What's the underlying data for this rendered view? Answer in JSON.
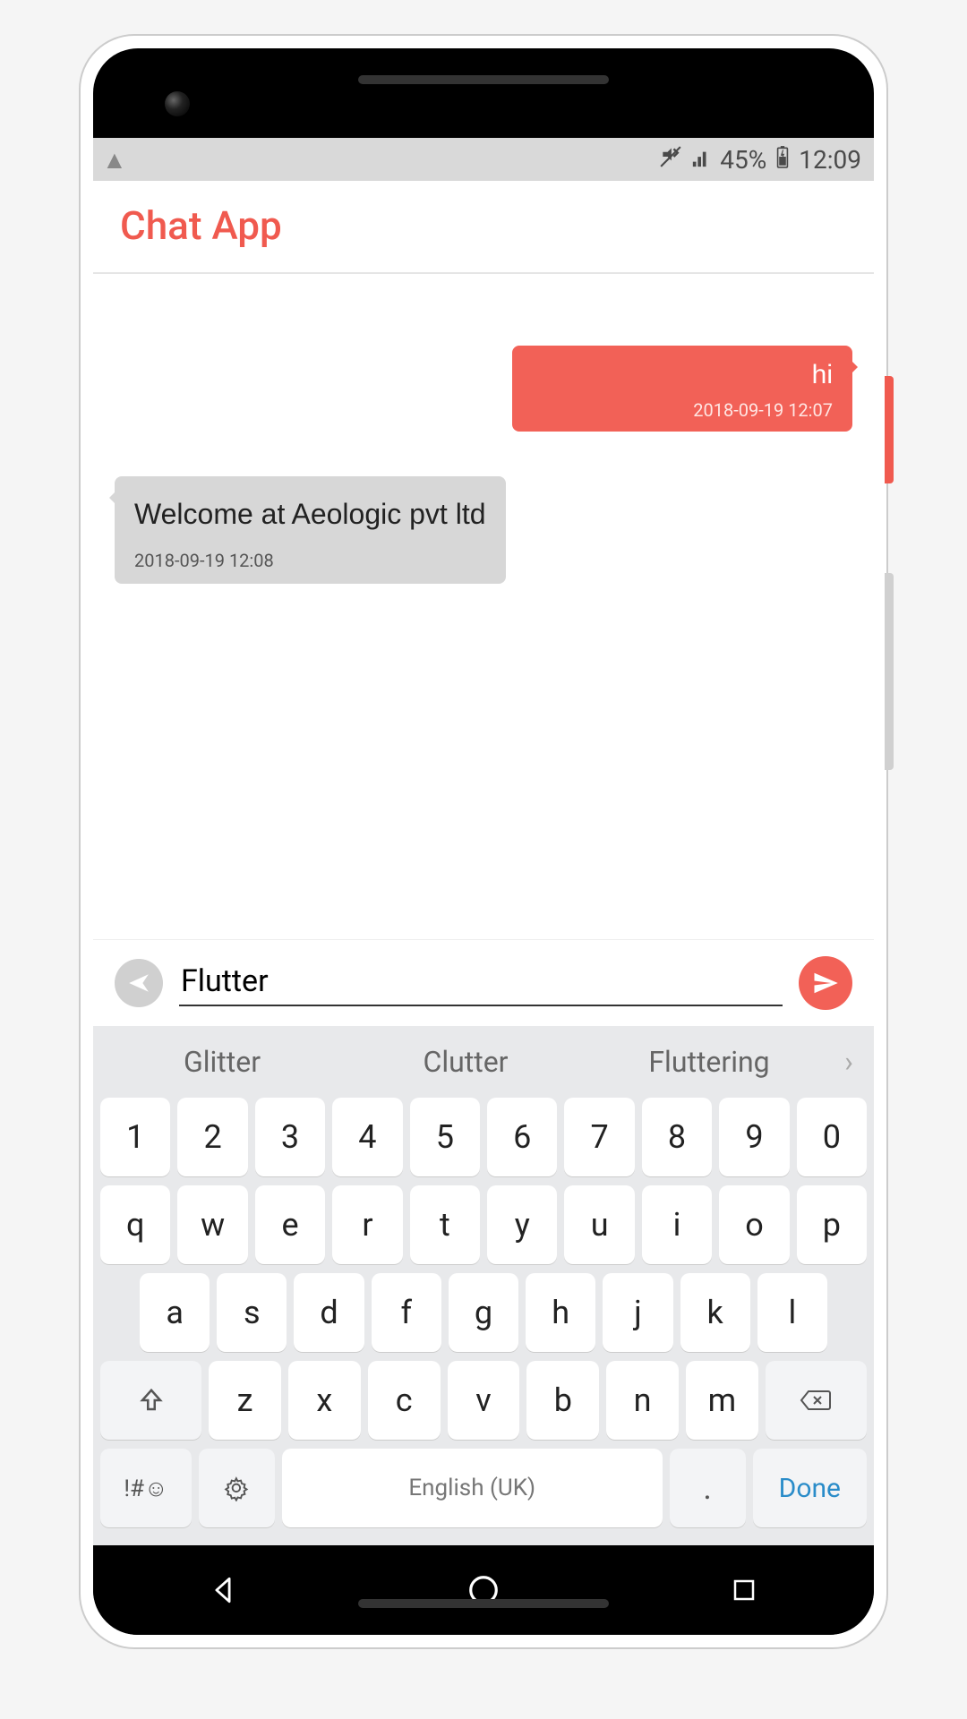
{
  "status_bar": {
    "battery_text": "45%",
    "time": "12:09"
  },
  "app": {
    "title": "Chat App"
  },
  "chat": {
    "messages": [
      {
        "side": "out",
        "text": "hi",
        "time": "2018-09-19 12:07"
      },
      {
        "side": "in",
        "text": "Welcome at Aeologic pvt ltd",
        "time": "2018-09-19 12:08"
      }
    ]
  },
  "composer": {
    "value": "Flutter"
  },
  "keyboard": {
    "suggestions": [
      "Glitter",
      "Clutter",
      "Fluttering"
    ],
    "row_num": [
      "1",
      "2",
      "3",
      "4",
      "5",
      "6",
      "7",
      "8",
      "9",
      "0"
    ],
    "row1": [
      "q",
      "w",
      "e",
      "r",
      "t",
      "y",
      "u",
      "i",
      "o",
      "p"
    ],
    "row2": [
      "a",
      "s",
      "d",
      "f",
      "g",
      "h",
      "j",
      "k",
      "l"
    ],
    "row3": [
      "z",
      "x",
      "c",
      "v",
      "b",
      "n",
      "m"
    ],
    "symbols_label": "!#☺",
    "space_label": "English (UK)",
    "period_label": ".",
    "done_label": "Done"
  }
}
